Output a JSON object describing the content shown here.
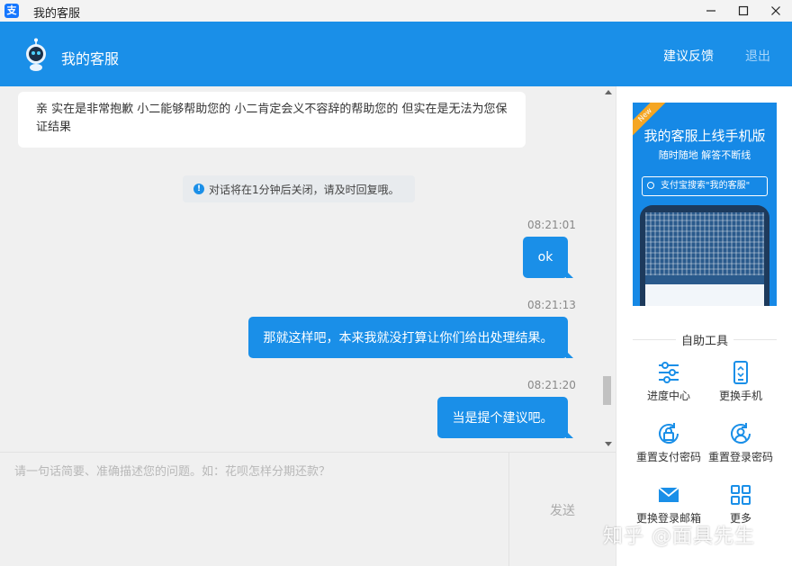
{
  "window": {
    "app_icon": "支",
    "title": "我的客服"
  },
  "header": {
    "title": "我的客服",
    "feedback_label": "建议反馈",
    "logout_label": "退出"
  },
  "chat": {
    "messages": [
      {
        "side": "left",
        "text": "亲 实在是非常抱歉 小二能够帮助您的 小二肯定会义不容辞的帮助您的 但实在是无法为您保证结果"
      },
      {
        "side": "system",
        "text": "对话将在1分钟后关闭，请及时回复哦。"
      },
      {
        "side": "right",
        "time": "08:21:01",
        "text": "ok"
      },
      {
        "side": "right",
        "time": "08:21:13",
        "text": "那就这样吧，本来我就没打算让你们给出处理结果。"
      },
      {
        "side": "right",
        "time": "08:21:20",
        "text": "当是提个建议吧。"
      }
    ]
  },
  "input": {
    "placeholder": "请一句话简要、准确描述您的问题。如：花呗怎样分期还款？",
    "send_label": "发送"
  },
  "sidebar": {
    "ad": {
      "badge": "New",
      "title": "我的客服上线手机版",
      "subtitle": "随时随地 解答不断线",
      "search_text": "支付宝搜索\"我的客服\""
    },
    "tools_title": "自助工具",
    "tools": [
      {
        "label": "进度中心",
        "icon": "progress-icon"
      },
      {
        "label": "更换手机",
        "icon": "phone-icon"
      },
      {
        "label": "重置支付密码",
        "icon": "pay-lock-icon"
      },
      {
        "label": "重置登录密码",
        "icon": "user-lock-icon"
      },
      {
        "label": "更换登录邮箱",
        "icon": "mail-icon"
      },
      {
        "label": "更多",
        "icon": "grid-icon"
      }
    ]
  },
  "watermark": "知乎 @面具先生",
  "colors": {
    "primary": "#1a8fe8",
    "chat_bg": "#f0f0f0"
  }
}
